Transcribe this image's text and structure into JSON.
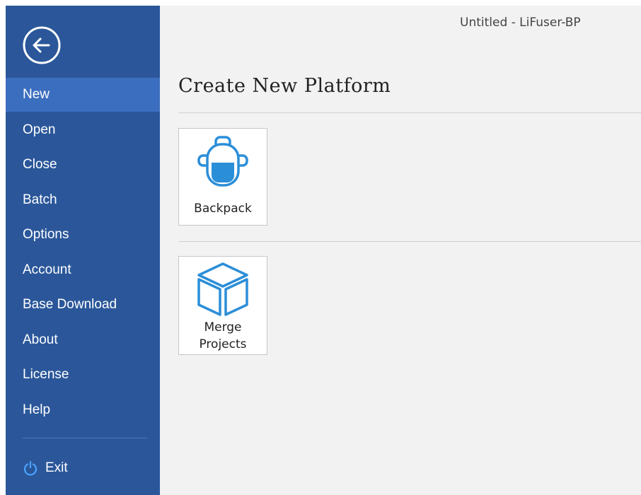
{
  "window": {
    "title": "Untitled - LiFuser-BP"
  },
  "sidebar": {
    "back_icon": "arrow-left-circle-icon",
    "items": [
      {
        "label": "New",
        "selected": true
      },
      {
        "label": "Open"
      },
      {
        "label": "Close"
      },
      {
        "label": "Batch"
      },
      {
        "label": "Options"
      },
      {
        "label": "Account"
      },
      {
        "label": "Base Download"
      },
      {
        "label": "About"
      },
      {
        "label": "License"
      },
      {
        "label": "Help"
      }
    ],
    "exit": {
      "label": "Exit",
      "icon": "power-icon"
    }
  },
  "main": {
    "title": "Create New Platform",
    "tiles": [
      {
        "line1": "Backpack",
        "icon": "backpack-icon"
      },
      {
        "line1": "Merge",
        "line2": "Projects",
        "icon": "cube-icon"
      }
    ]
  },
  "colors": {
    "sidebar_bg": "#2b579a",
    "sidebar_selected": "#3c6ebf",
    "accent_icon": "#2b8ed8",
    "content_bg": "#f2f2f2"
  }
}
